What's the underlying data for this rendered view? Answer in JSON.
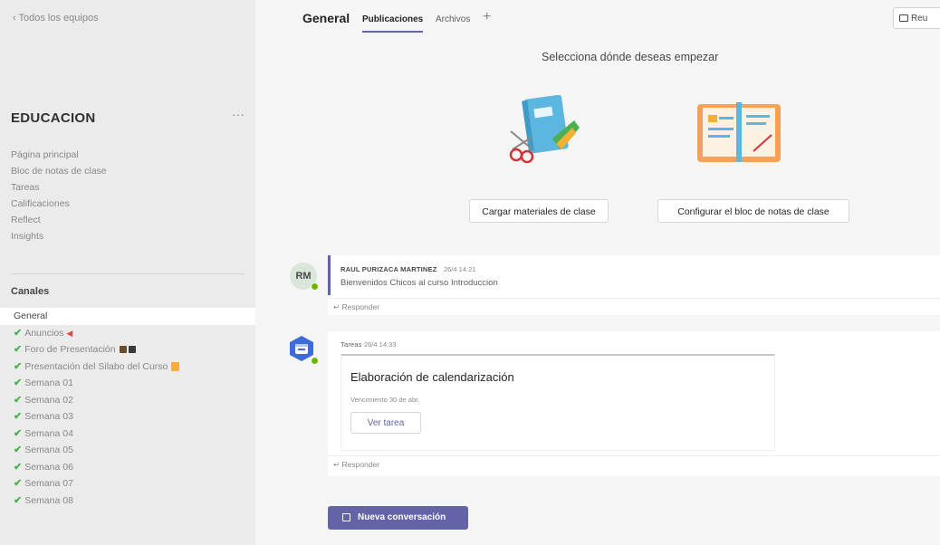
{
  "sidebar": {
    "back_label": "‹  Todos los equipos",
    "team_name": "EDUCACION",
    "team_more": "···",
    "tabs": [
      "Página principal",
      "Bloc de notas de clase",
      "Tareas",
      "Calificaciones",
      "Reflect",
      "Insights"
    ],
    "channels_label": "Canales",
    "channels": [
      {
        "label": "General",
        "checked": false,
        "active": true
      },
      {
        "label": "Anuncios",
        "checked": true
      },
      {
        "label": "Foro de Presentación",
        "checked": true
      },
      {
        "label": "Presentación del Silabo del Curso",
        "checked": true
      },
      {
        "label": "Semana 01",
        "checked": true
      },
      {
        "label": "Semana 02",
        "checked": true
      },
      {
        "label": "Semana 03",
        "checked": true
      },
      {
        "label": "Semana 04",
        "checked": true
      },
      {
        "label": "Semana 05",
        "checked": true
      },
      {
        "label": "Semana 06",
        "checked": true
      },
      {
        "label": "Semana 07",
        "checked": true
      },
      {
        "label": "Semana 08",
        "checked": true
      }
    ]
  },
  "header": {
    "channel_title": "General",
    "tabs": [
      "Publicaciones",
      "Archivos"
    ],
    "add_tab": "+",
    "meet_label": "Reu"
  },
  "onboarding": {
    "prompt": "Selecciona dónde deseas empezar",
    "upload_button": "Cargar materiales de clase",
    "notebook_button": "Configurar el bloc de notas de clase"
  },
  "posts": {
    "first": {
      "avatar_initials": "RM",
      "author": "RAUL PURIZACA MARTINEZ",
      "time": "26/4 14:21",
      "body": "Bienvenidos Chicos al curso Introduccion",
      "reply": "Responder"
    },
    "second": {
      "author": "Tareas",
      "time": "26/4 14:33",
      "card_title": "Elaboración de calendarización",
      "due": "Vencimiento 30 de abr.",
      "view_button": "Ver tarea",
      "reply": "Responder"
    }
  },
  "new_conversation": "Nueva conversación",
  "colors": {
    "accent": "#6264a7",
    "check": "#4caf50",
    "presence": "#6bb700"
  }
}
